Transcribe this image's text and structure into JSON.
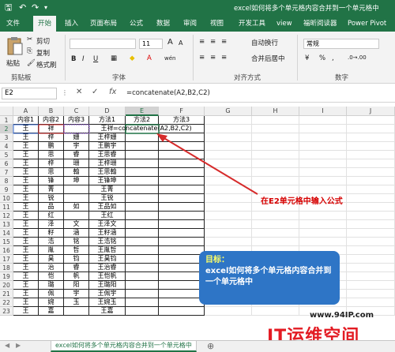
{
  "title_bar": {
    "title": "excel如何将多个单元格内容合并到一个单元格中"
  },
  "tabs": [
    "文件",
    "开始",
    "插入",
    "页面布局",
    "公式",
    "数据",
    "审阅",
    "视图",
    "开发工具",
    "view",
    "福昕阅读器",
    "Power Pivot"
  ],
  "active_tab": "开始",
  "clipboard": {
    "paste": "粘贴",
    "cut": "剪切",
    "copy": "复制",
    "format_painter": "格式刷",
    "group": "剪贴板"
  },
  "font": {
    "size": "11",
    "bold": "B",
    "italic": "I",
    "underline": "U",
    "wen": "wén",
    "group": "字体"
  },
  "alignment": {
    "wrap": "自动换行",
    "merge": "合并后居中",
    "group": "对齐方式"
  },
  "number": {
    "format": "常规",
    "percent": "%",
    "comma": ",",
    "group": "数字"
  },
  "formula_bar": {
    "name_box": "E2",
    "cancel": "✕",
    "enter": "✓",
    "fx": "fx",
    "formula": "=concatenate(A2,B2,C2)"
  },
  "columns": [
    "A",
    "B",
    "C",
    "D",
    "E",
    "F",
    "G",
    "H",
    "I",
    "J"
  ],
  "rows": [
    "1",
    "2",
    "3",
    "4",
    "5",
    "6",
    "7",
    "8",
    "9",
    "10",
    "11",
    "12",
    "13",
    "14",
    "15",
    "16",
    "17",
    "18",
    "19",
    "20",
    "21",
    "22",
    "23"
  ],
  "table": [
    [
      "内容1",
      "内容2",
      "内容3",
      "方法1",
      "方法2",
      "方法3"
    ],
    [
      "王",
      "祥",
      "",
      "王祥",
      "=concatenate(A2,B2,C2)",
      ""
    ],
    [
      "王",
      "梓",
      "姗",
      "王梓姗",
      "",
      ""
    ],
    [
      "王",
      "鹏",
      "宇",
      "王鹏宇",
      "",
      ""
    ],
    [
      "王",
      "思",
      "睿",
      "王思睿",
      "",
      ""
    ],
    [
      "王",
      "梓",
      "珊",
      "王梓珊",
      "",
      ""
    ],
    [
      "王",
      "思",
      "翰",
      "王思翰",
      "",
      ""
    ],
    [
      "王",
      "锋",
      "坤",
      "王锋坤",
      "",
      ""
    ],
    [
      "王",
      "菁",
      "",
      "王菁",
      "",
      ""
    ],
    [
      "王",
      "锐",
      "",
      "王锐",
      "",
      ""
    ],
    [
      "王",
      "品",
      "如",
      "王品如",
      "",
      ""
    ],
    [
      "王",
      "红",
      "",
      "王红",
      "",
      ""
    ],
    [
      "王",
      "泽",
      "文",
      "王泽文",
      "",
      ""
    ],
    [
      "王",
      "籽",
      "涵",
      "王籽涵",
      "",
      ""
    ],
    [
      "王",
      "浩",
      "铭",
      "王浩铭",
      "",
      ""
    ],
    [
      "王",
      "胤",
      "哲",
      "王胤哲",
      "",
      ""
    ],
    [
      "王",
      "昊",
      "钧",
      "王昊钧",
      "",
      ""
    ],
    [
      "王",
      "治",
      "睿",
      "王治睿",
      "",
      ""
    ],
    [
      "王",
      "恺",
      "帆",
      "王恺帆",
      "",
      ""
    ],
    [
      "王",
      "璐",
      "阳",
      "王璐阳",
      "",
      ""
    ],
    [
      "王",
      "佩",
      "宇",
      "王佩宇",
      "",
      ""
    ],
    [
      "王",
      "婉",
      "玉",
      "王婉玉",
      "",
      ""
    ],
    [
      "王",
      "嘉",
      "",
      "王嘉",
      "",
      ""
    ]
  ],
  "callout": "在E2单元格中输入公式",
  "goal": {
    "title": "目标：",
    "text": "excel如何将多个单元格内容合并到一个单元格中"
  },
  "watermark": {
    "url": "www.94IP.com",
    "logo": "IT运维空间"
  },
  "sheet_tab": "excel如何将多个单元格内容合并到一个单元格中",
  "colors": {
    "accent": "#217346",
    "arrow": "#d62b2b",
    "goal_box": "#2e75c6"
  }
}
